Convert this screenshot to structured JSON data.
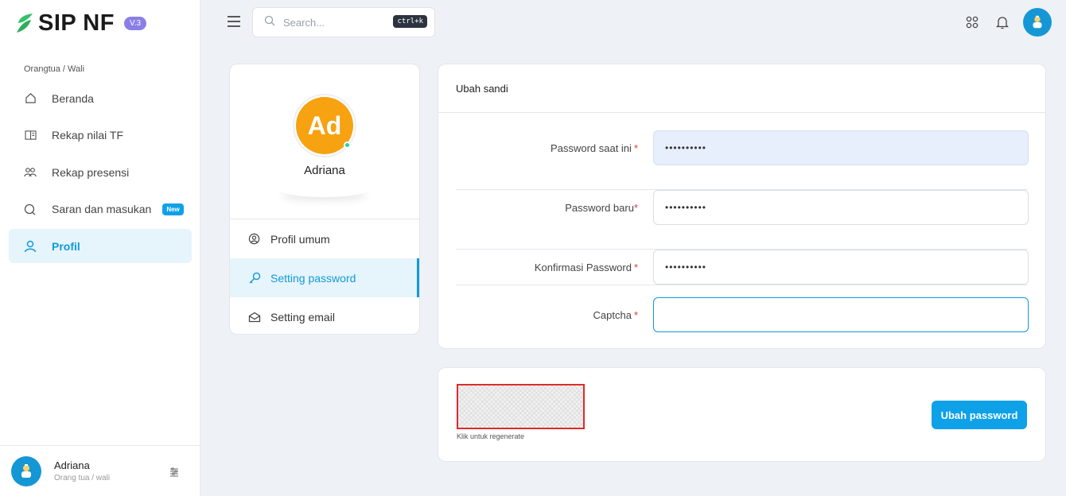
{
  "brand": {
    "name": "SIP NF",
    "version": "V.3"
  },
  "sidebar": {
    "section_title": "Orangtua / Wali",
    "items": [
      {
        "label": "Beranda",
        "icon": "home-icon"
      },
      {
        "label": "Rekap nilai TF",
        "icon": "book-icon"
      },
      {
        "label": "Rekap presensi",
        "icon": "users-icon"
      },
      {
        "label": "Saran dan masukan",
        "icon": "chat-icon",
        "badge": "New"
      },
      {
        "label": "Profil",
        "icon": "user-icon",
        "active": true
      }
    ],
    "user": {
      "name": "Adriana",
      "role": "Orang tua / wali"
    }
  },
  "topbar": {
    "search_placeholder": "Search...",
    "shortcut": "ctrl+k"
  },
  "profile": {
    "initials": "Ad",
    "name": "Adriana",
    "menu": [
      {
        "label": "Profil umum",
        "icon": "user-circle-icon"
      },
      {
        "label": "Setting password",
        "icon": "key-icon",
        "active": true
      },
      {
        "label": "Setting email",
        "icon": "mail-icon"
      }
    ]
  },
  "form": {
    "title": "Ubah sandi",
    "fields": [
      {
        "label": "Password saat ini",
        "value": "••••••••••"
      },
      {
        "label": "Password baru",
        "value": "••••••••••"
      },
      {
        "label": "Konfirmasi Password",
        "value": "••••••••••"
      },
      {
        "label": "Captcha",
        "value": ""
      }
    ],
    "required_mark": "*"
  },
  "captcha": {
    "hint": "Klik untuk regenerate",
    "submit_label": "Ubah password"
  },
  "colors": {
    "accent": "#0ea1e8",
    "active_bg": "#e6f4fc",
    "avatar_orange": "#f7a211",
    "online": "#22d3a0",
    "required": "#e03a3a",
    "brand_green": "#35c06a"
  }
}
